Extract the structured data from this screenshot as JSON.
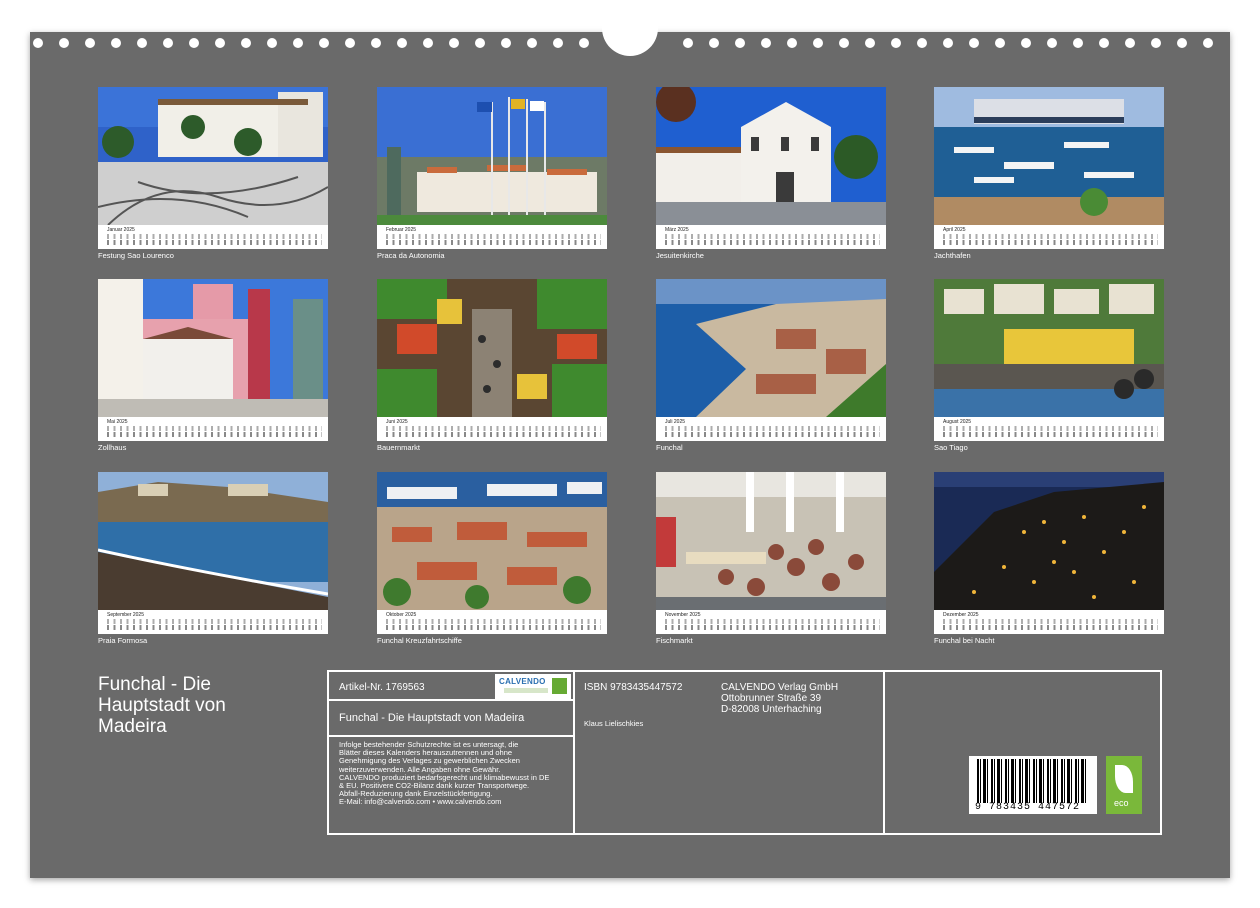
{
  "months": [
    {
      "month_label": "Januar 2025",
      "caption": "Festung Sao Lourenco"
    },
    {
      "month_label": "Februar 2025",
      "caption": "Praca da Autonomia"
    },
    {
      "month_label": "März 2025",
      "caption": "Jesuitenkirche"
    },
    {
      "month_label": "April 2025",
      "caption": "Jachthafen"
    },
    {
      "month_label": "Mai 2025",
      "caption": "Zollhaus"
    },
    {
      "month_label": "Juni 2025",
      "caption": "Bauernmarkt"
    },
    {
      "month_label": "Juli 2025",
      "caption": "Funchal"
    },
    {
      "month_label": "August 2025",
      "caption": "Sao Tiago"
    },
    {
      "month_label": "September 2025",
      "caption": "Praia Formosa"
    },
    {
      "month_label": "Oktober 2025",
      "caption": "Funchal Kreuzfahrtschiffe"
    },
    {
      "month_label": "November 2025",
      "caption": "Fischmarkt"
    },
    {
      "month_label": "Dezember 2025",
      "caption": "Funchal bei Nacht"
    }
  ],
  "title": "Funchal - Die Hauptstadt von Madeira",
  "info": {
    "artikel": "Artikel-Nr. 1769563",
    "logo_text": "CALVENDO",
    "product_title": "Funchal - Die Hauptstadt von Madeira",
    "legal": [
      "Infolge bestehender Schutzrechte ist es untersagt, die",
      "Blätter dieses Kalenders herauszutrennen und ohne",
      "Genehmigung des Verlages zu gewerblichen Zwecken",
      "weiterzuverwenden. Alle Angaben ohne Gewähr.",
      "CALVENDO produziert bedarfsgerecht und klimabewusst in DE",
      "& EU. Positivere CO2-Bilanz dank kurzer Transportwege.",
      "Abfall-Reduzierung dank Einzelstückfertigung.",
      "E-Mail: info@calvendo.com • www.calvendo.com"
    ],
    "isbn": "ISBN 9783435447572",
    "author": "Klaus Lielischkies",
    "publisher": [
      "CALVENDO Verlag GmbH",
      "Ottobrunner Straße 39",
      "D-82008 Unterhaching"
    ],
    "barcode_number": "9 783435 447572",
    "eco_label": "eco"
  }
}
